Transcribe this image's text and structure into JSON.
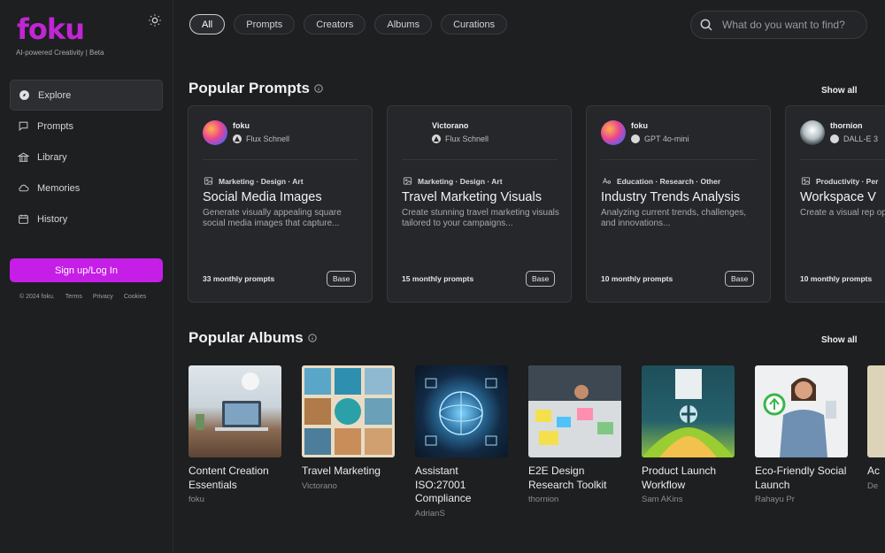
{
  "brand": {
    "logo": "foku",
    "tagline": "AI-powered Creativity | Beta",
    "accent": "#c51ee6"
  },
  "sidebar": {
    "items": [
      {
        "label": "Explore",
        "icon": "compass-icon",
        "active": true
      },
      {
        "label": "Prompts",
        "icon": "chat-bubble-icon"
      },
      {
        "label": "Library",
        "icon": "library-icon"
      },
      {
        "label": "Memories",
        "icon": "cloud-icon"
      },
      {
        "label": "History",
        "icon": "calendar-icon"
      }
    ],
    "signup": "Sign up/Log In",
    "footer": {
      "copyright": "© 2024 foku.",
      "terms": "Terms",
      "privacy": "Privacy",
      "cookies": "Cookies"
    }
  },
  "filters": [
    "All",
    "Prompts",
    "Creators",
    "Albums",
    "Curations"
  ],
  "search": {
    "placeholder": "What do you want to find?"
  },
  "prompts_section": {
    "title": "Popular Prompts",
    "show_all": "Show all"
  },
  "prompt_cards": [
    {
      "author": "foku",
      "model": "Flux Schnell",
      "tags": "Marketing · Design · Art",
      "title": "Social Media Images",
      "desc": "Generate visually appealing square social media images that capture...",
      "count": "33 monthly prompts",
      "badge": "Base"
    },
    {
      "author": "Victorano",
      "model": "Flux Schnell",
      "tags": "Marketing · Design · Art",
      "title": "Travel Marketing Visuals",
      "desc": "Create stunning travel marketing visuals tailored to your campaigns...",
      "count": "15 monthly prompts",
      "badge": "Base"
    },
    {
      "author": "foku",
      "model": "GPT 4o-mini",
      "tags": "Education · Research · Other",
      "title": "Industry Trends Analysis",
      "desc": "Analyzing current trends, challenges, and innovations...",
      "count": "10 monthly prompts",
      "badge": "Base"
    },
    {
      "author": "thornion",
      "model": "DALL-E 3",
      "tags": "Productivity · Per",
      "title": "Workspace V",
      "desc": "Create a visual rep optimized workspa",
      "count": "10 monthly prompts",
      "badge": ""
    }
  ],
  "albums_section": {
    "title": "Popular Albums",
    "show_all": "Show all"
  },
  "albums": [
    {
      "name": "Content Creation Essentials",
      "creator": "foku"
    },
    {
      "name": "Travel Marketing",
      "creator": "Victorano"
    },
    {
      "name": "Assistant ISO:27001 Compliance",
      "creator": "AdrianS"
    },
    {
      "name": "E2E Design Research Toolkit",
      "creator": "thornion"
    },
    {
      "name": "Product Launch Workflow",
      "creator": "Sam AKins"
    },
    {
      "name": "Eco-Friendly Social Launch",
      "creator": "Rahayu Pr"
    },
    {
      "name": "Ac",
      "creator": "De"
    }
  ]
}
